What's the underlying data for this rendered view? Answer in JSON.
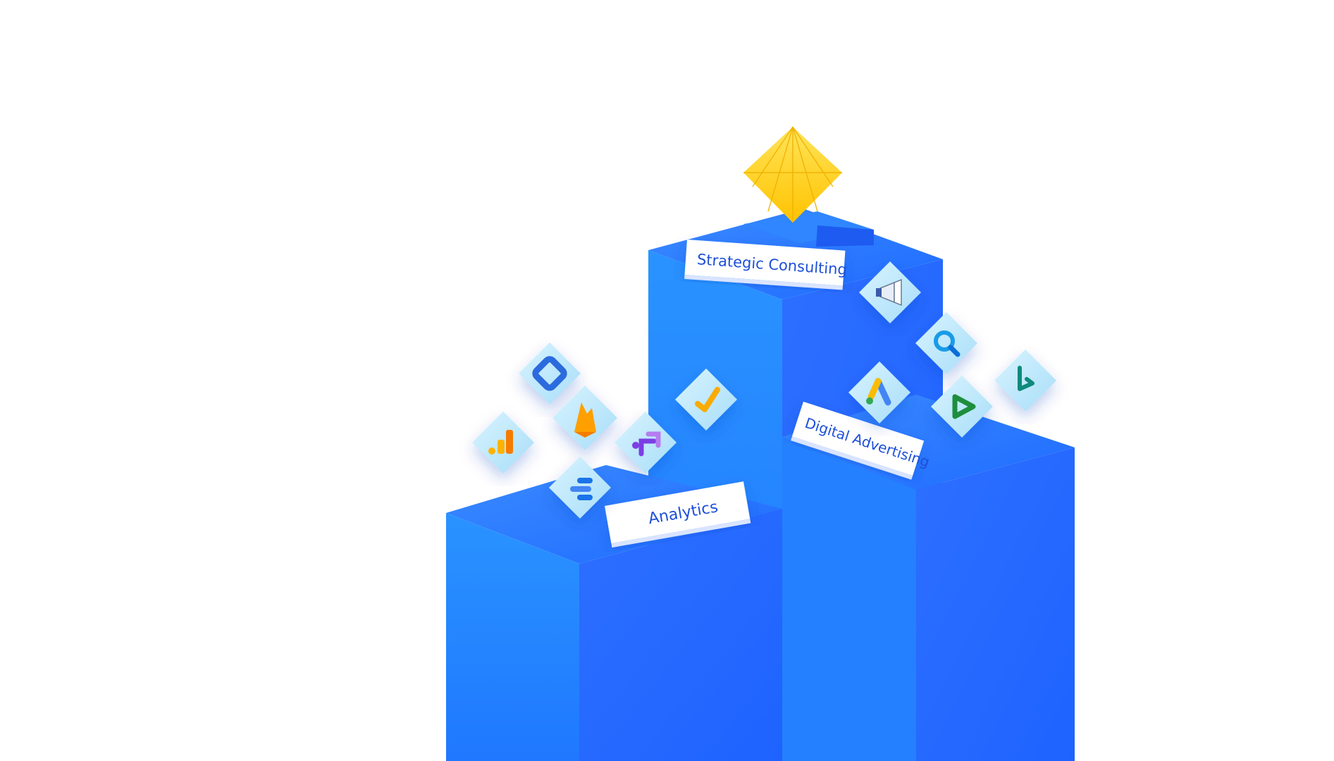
{
  "labels": {
    "strategic": "Strategic Consulting",
    "digital": "Digital Advertising",
    "analytics": "Analytics"
  },
  "icons": [
    "google-tag-manager-icon",
    "firebase-icon",
    "google-analytics-icon",
    "google-optimize-icon",
    "google-data-studio-icon",
    "google-analytics-360-icon",
    "google-ads-icon",
    "megaphone-icon",
    "search-icon",
    "google-display-video-icon",
    "bing-icon"
  ],
  "colors": {
    "block_front": "#1f7dff",
    "block_side": "#1a66f5",
    "block_top": "#2f7bff",
    "icon_tile": "#bfe7fb",
    "label_text": "#1d4fd8",
    "gem": "#ffd21a"
  }
}
